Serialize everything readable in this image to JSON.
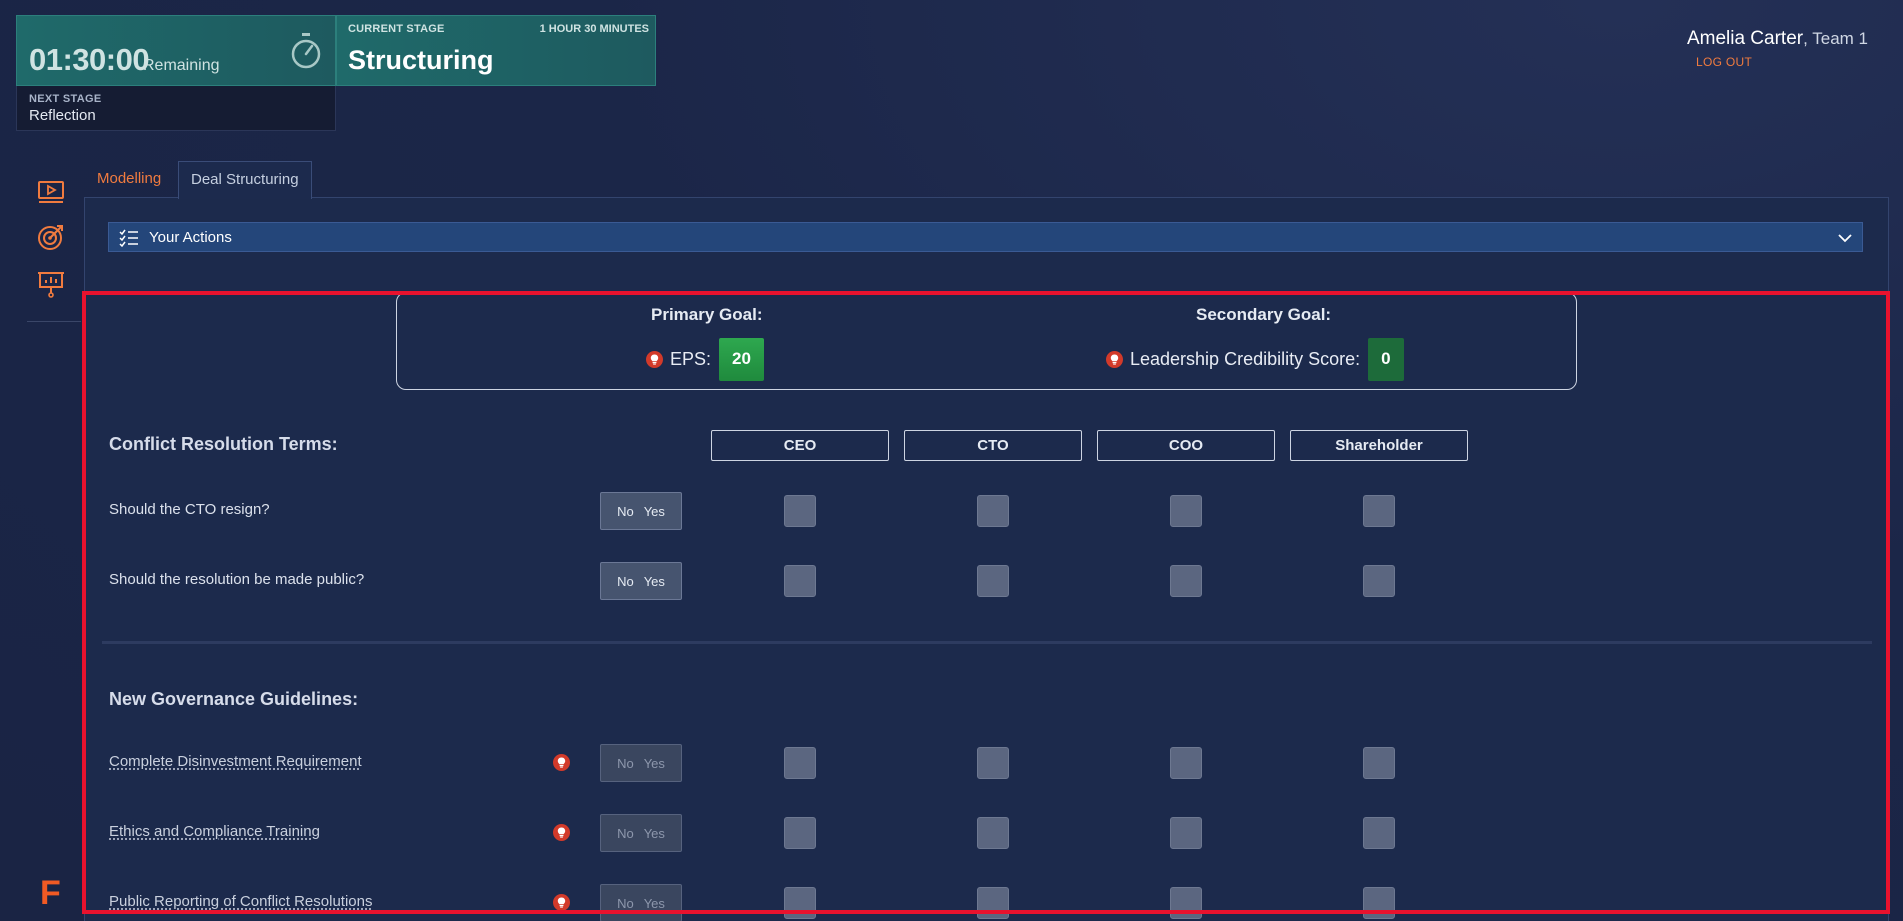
{
  "timer": {
    "value": "01:30:00",
    "suffix": "Remaining",
    "next_stage_label": "NEXT STAGE",
    "next_stage_value": "Reflection"
  },
  "stage": {
    "label": "CURRENT STAGE",
    "duration": "1 HOUR 30 MINUTES",
    "name": "Structuring"
  },
  "user": {
    "name": "Amelia Carter",
    "team": ", Team 1",
    "logout": "LOG OUT"
  },
  "rail": {
    "icons": [
      "video-icon",
      "target-icon",
      "presentation-icon"
    ],
    "brand": "F"
  },
  "tabs": [
    {
      "label": "Modelling",
      "active": false
    },
    {
      "label": "Deal Structuring",
      "active": true
    }
  ],
  "actions": {
    "label": "Your Actions"
  },
  "goals": {
    "primary": {
      "heading": "Primary Goal:",
      "label": "EPS:",
      "value": "20"
    },
    "secondary": {
      "heading": "Secondary Goal:",
      "label": "Leadership Credibility Score:",
      "value": "0"
    }
  },
  "conflict": {
    "heading": "Conflict Resolution Terms:",
    "roles": [
      "CEO",
      "CTO",
      "COO",
      "Shareholder"
    ],
    "rows": [
      {
        "label": "Should the CTO resign?",
        "no": "No",
        "yes": "Yes"
      },
      {
        "label": "Should the resolution be made public?",
        "no": "No",
        "yes": "Yes"
      }
    ]
  },
  "governance": {
    "heading": "New Governance Guidelines:",
    "rows": [
      {
        "label": "Complete Disinvestment Requirement",
        "no": "No",
        "yes": "Yes"
      },
      {
        "label": "Ethics and Compliance Training",
        "no": "No",
        "yes": "Yes"
      },
      {
        "label": "Public Reporting of Conflict Resolutions",
        "no": "No",
        "yes": "Yes"
      }
    ]
  },
  "colors": {
    "accent_orange": "#f07b3f",
    "teal": "#1f6a6a",
    "highlight_red": "#e8122e",
    "eps_green": "#2ea84f",
    "lcs_green": "#1d6b3a"
  }
}
